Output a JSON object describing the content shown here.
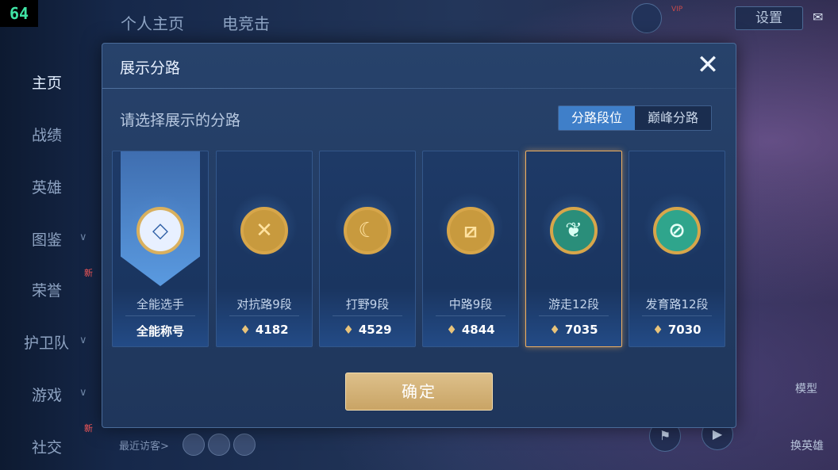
{
  "overlay": {
    "fps": "64"
  },
  "topbar": {
    "tabs": [
      "个人主页",
      "电竞击"
    ],
    "settings_label": "设置",
    "vip_label": "VIP"
  },
  "sidebar": {
    "items": [
      {
        "label": "主页",
        "active": true
      },
      {
        "label": "战绩"
      },
      {
        "label": "英雄"
      },
      {
        "label": "图鉴",
        "expandable": true
      },
      {
        "label": "荣誉",
        "badge": "新"
      },
      {
        "label": "护卫队",
        "expandable": true
      },
      {
        "label": "游戏",
        "expandable": true
      },
      {
        "label": "社交",
        "badge": "新"
      }
    ]
  },
  "footer": {
    "visitors_label": "最近访客>"
  },
  "right_panel": {
    "model_label": "模型",
    "switch_hero_label": "换英雄"
  },
  "dialog": {
    "title": "展示分路",
    "prompt": "请选择展示的分路",
    "segments": [
      {
        "label": "分路段位",
        "active": true
      },
      {
        "label": "巅峰分路",
        "active": false
      }
    ],
    "cards": [
      {
        "label": "全能选手",
        "score": "全能称号",
        "emblem": "all-round",
        "highlight": true
      },
      {
        "label": "对抗路9段",
        "score": "4182",
        "emblem": "clash-lane"
      },
      {
        "label": "打野9段",
        "score": "4529",
        "emblem": "jungle"
      },
      {
        "label": "中路9段",
        "score": "4844",
        "emblem": "mid-lane"
      },
      {
        "label": "游走12段",
        "score": "7035",
        "emblem": "roam",
        "selected": true
      },
      {
        "label": "发育路12段",
        "score": "7030",
        "emblem": "farm-lane"
      }
    ],
    "confirm_label": "确定"
  },
  "colors": {
    "accent": "#3f7fc9",
    "confirm": "#d4b074",
    "selected_border": "#f0b060"
  }
}
